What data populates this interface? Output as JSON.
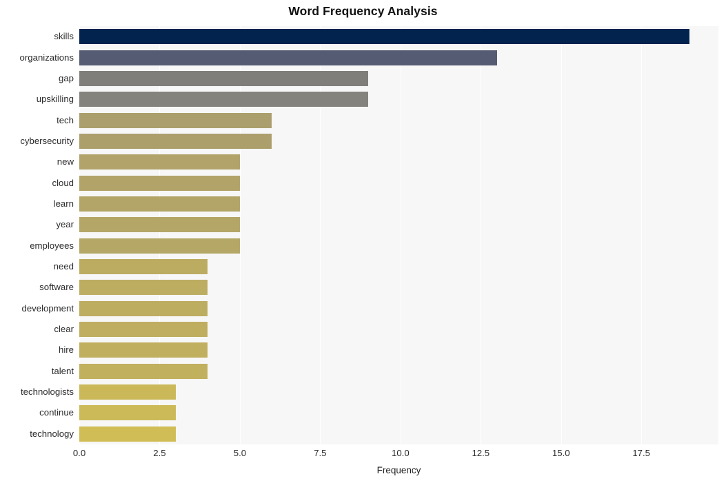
{
  "chart_data": {
    "type": "bar",
    "orientation": "horizontal",
    "title": "Word Frequency Analysis",
    "xlabel": "Frequency",
    "ylabel": "",
    "xlim": [
      0,
      19.9
    ],
    "xticks": [
      "0.0",
      "2.5",
      "5.0",
      "7.5",
      "10.0",
      "12.5",
      "15.0",
      "17.5"
    ],
    "xtick_values": [
      0,
      2.5,
      5,
      7.5,
      10,
      12.5,
      15,
      17.5
    ],
    "grid": true,
    "legend": "none",
    "categories": [
      "skills",
      "organizations",
      "gap",
      "upskilling",
      "tech",
      "cybersecurity",
      "new",
      "cloud",
      "learn",
      "year",
      "employees",
      "need",
      "software",
      "development",
      "clear",
      "hire",
      "talent",
      "technologists",
      "continue",
      "technology"
    ],
    "values": [
      19,
      13,
      9,
      9,
      6,
      6,
      5,
      5,
      5,
      5,
      5,
      4,
      4,
      4,
      4,
      4,
      4,
      3,
      3,
      3
    ],
    "bar_colors": [
      "#03234f",
      "#555b72",
      "#807e7b",
      "#84827c",
      "#ab9f6d",
      "#ac9f6c",
      "#b1a36a",
      "#b2a469",
      "#b3a568",
      "#b4a667",
      "#b5a766",
      "#bcac62",
      "#bdad61",
      "#bdad61",
      "#bfae60",
      "#c0af5f",
      "#c1b05e",
      "#cbb959",
      "#ccba58",
      "#d0bd56"
    ],
    "plot_background": "#f7f7f8",
    "figure_background": "#ffffff",
    "grid_color": "#ffffff"
  }
}
